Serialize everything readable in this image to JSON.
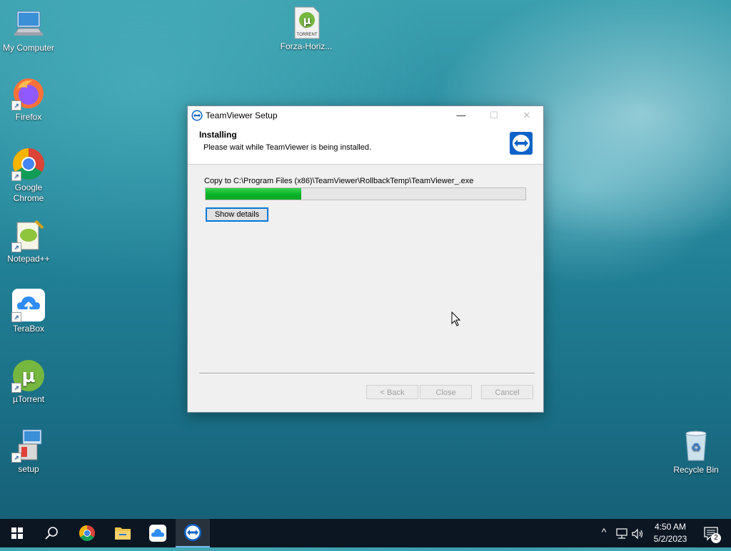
{
  "desktop": {
    "icons": [
      {
        "label": "My Computer"
      },
      {
        "label": "Firefox"
      },
      {
        "label": "Google Chrome"
      },
      {
        "label": "Notepad++"
      },
      {
        "label": "TeraBox"
      },
      {
        "label": "µTorrent"
      },
      {
        "label": "setup"
      },
      {
        "label": "Forza-Horiz..."
      },
      {
        "label": "Recycle Bin"
      }
    ],
    "torrent_file_badge": "TORRENT"
  },
  "dialog": {
    "title": "TeamViewer Setup",
    "header_title": "Installing",
    "header_subtitle": "Please wait while TeamViewer is being installed.",
    "status_text": "Copy to C:\\Program Files (x86)\\TeamViewer\\RollbackTemp\\TeamViewer_.exe",
    "progress": 0.3,
    "show_details_label": "Show details",
    "back_label": "< Back",
    "close_label": "Close",
    "cancel_label": "Cancel",
    "controls": {
      "minimize": "—",
      "maximize": "☐",
      "close": "✕"
    }
  },
  "taskbar": {
    "pinned": [
      "start-icon",
      "search-icon",
      "chrome-icon",
      "file-explorer-icon",
      "terabox-icon",
      "teamviewer-icon"
    ],
    "time": "4:50 AM",
    "date": "5/2/2023",
    "notification_count": "2",
    "tray_chevron": "^",
    "accent_color": "#0078d7"
  }
}
